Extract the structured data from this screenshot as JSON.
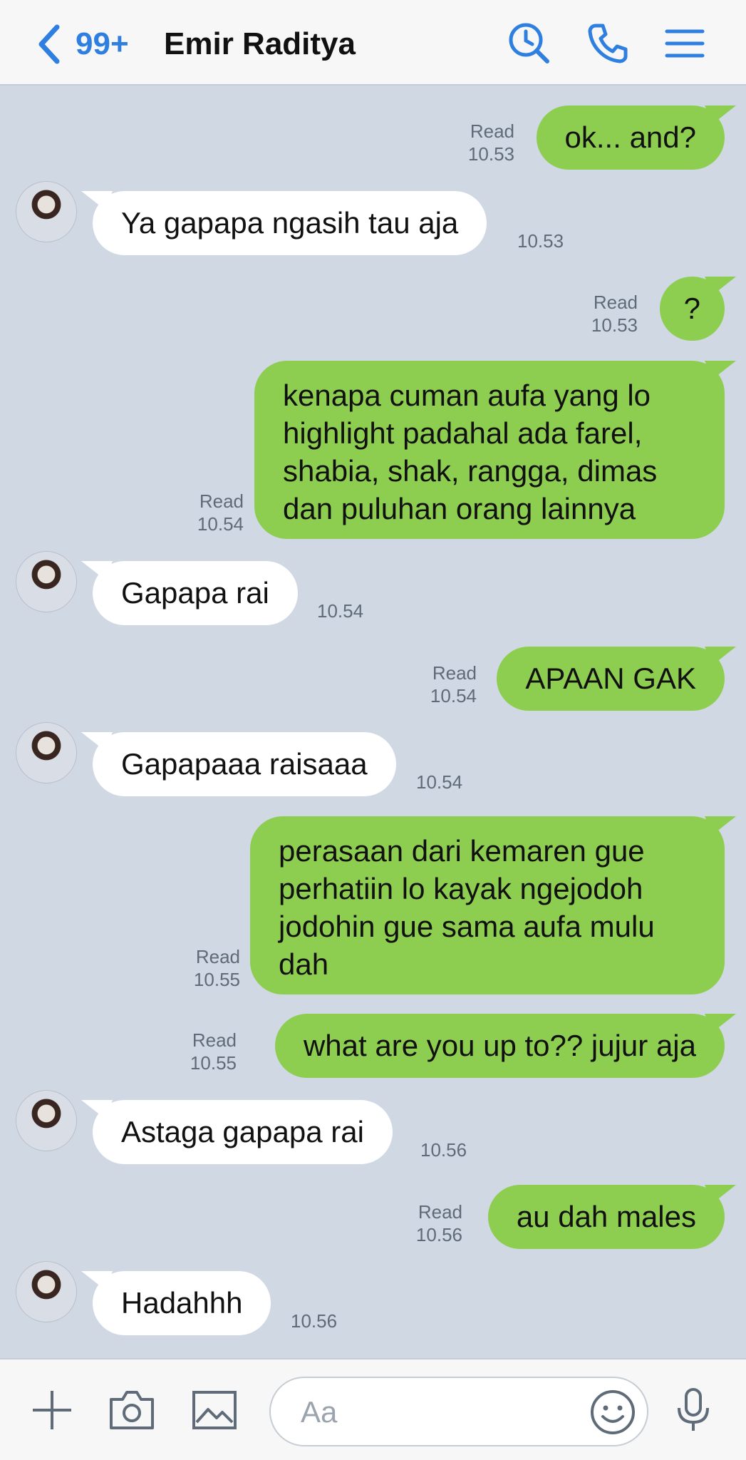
{
  "header": {
    "unread_count": "99+",
    "contact_name": "Emir Raditya",
    "icons": [
      "back-icon",
      "search-clock-icon",
      "phone-icon",
      "menu-icon"
    ]
  },
  "messages": [
    {
      "dir": "out",
      "text": "ok... and?",
      "status": "Read",
      "time": "10.53"
    },
    {
      "dir": "in",
      "text": "Ya gapapa ngasih tau aja",
      "time": "10.53"
    },
    {
      "dir": "out",
      "text": "?",
      "status": "Read",
      "time": "10.53"
    },
    {
      "dir": "out",
      "lines": [
        "kenapa cuman aufa yang lo",
        "highlight padahal ada farel,",
        "shabia, shak, rangga, dimas",
        "dan puluhan orang lainnya"
      ],
      "status": "Read",
      "time": "10.54"
    },
    {
      "dir": "in",
      "text": "Gapapa rai",
      "time": "10.54"
    },
    {
      "dir": "out",
      "text": "APAAN GAK",
      "status": "Read",
      "time": "10.54"
    },
    {
      "dir": "in",
      "text": "Gapapaaa raisaaa",
      "time": "10.54"
    },
    {
      "dir": "out",
      "lines": [
        "perasaan dari kemaren gue",
        "perhatiin lo kayak ngejodoh",
        "jodohin gue sama aufa mulu",
        "dah"
      ],
      "status": "Read",
      "time": "10.55"
    },
    {
      "dir": "out",
      "text": "what are you up to?? jujur aja",
      "status": "Read",
      "time": "10.55"
    },
    {
      "dir": "in",
      "text": "Astaga gapapa rai",
      "time": "10.56"
    },
    {
      "dir": "out",
      "text": "au dah males",
      "status": "Read",
      "time": "10.56"
    },
    {
      "dir": "in",
      "text": "Hadahhh",
      "time": "10.56"
    }
  ],
  "composer": {
    "placeholder": "Aa",
    "icons": [
      "plus-icon",
      "camera-icon",
      "image-icon",
      "emoji-icon",
      "microphone-icon"
    ]
  },
  "colors": {
    "background": "#cfd8e3",
    "outgoing_bubble": "#8dcd4f",
    "incoming_bubble": "#ffffff",
    "accent": "#2f7fe0"
  }
}
